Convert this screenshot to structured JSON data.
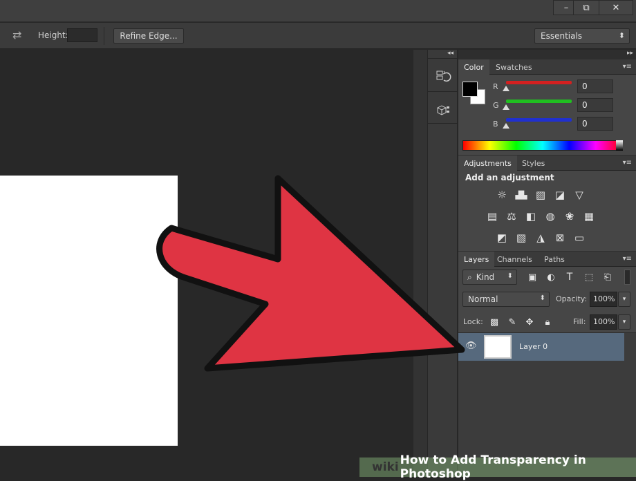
{
  "window": {
    "minimize_label": "–",
    "restore_label": "⧉",
    "close_label": "✕"
  },
  "options": {
    "swap_label": "⇄",
    "height_label": "Height:",
    "height_value": "",
    "refine_edge_label": "Refine Edge...",
    "workspace_value": "Essentials",
    "workspace_arrow": "⬍"
  },
  "dock": {
    "collapse_label": "◂◂",
    "expand_label": "▸▸"
  },
  "color_panel": {
    "tabs": [
      "Color",
      "Swatches"
    ],
    "channels": [
      {
        "label": "R",
        "value": "0"
      },
      {
        "label": "G",
        "value": "0"
      },
      {
        "label": "B",
        "value": "0"
      }
    ],
    "colors": {
      "red_slider": "#d42020",
      "green_slider": "#20c020",
      "blue_slider": "#2030d0"
    }
  },
  "adjustments_panel": {
    "tabs": [
      "Adjustments",
      "Styles"
    ],
    "title": "Add an adjustment"
  },
  "layers_panel": {
    "tabs": [
      "Layers",
      "Channels",
      "Paths"
    ],
    "kind_label": "Kind",
    "blend_mode": "Normal",
    "opacity_label": "Opacity:",
    "opacity_value": "100%",
    "lock_label": "Lock:",
    "fill_label": "Fill:",
    "fill_value": "100%",
    "layers": [
      {
        "name": "Layer 0"
      }
    ]
  },
  "overlay": {
    "arrow_color": "#df3443",
    "watermark_prefix": "wiki",
    "watermark_text": "How to Add Transparency in Photoshop"
  }
}
